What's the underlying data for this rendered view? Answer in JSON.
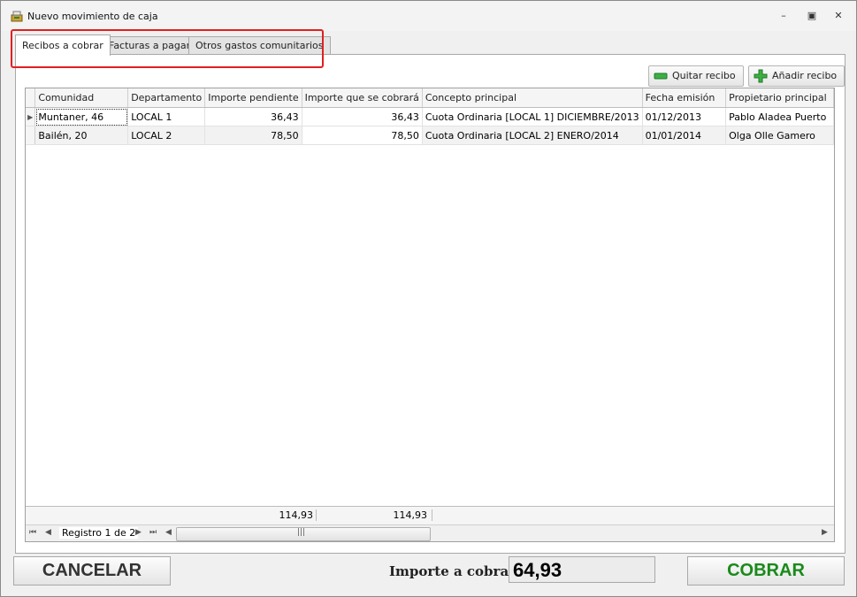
{
  "window": {
    "title": "Nuevo movimiento de caja",
    "controls": {
      "minimize": "–",
      "restore": "▣",
      "close": "✕"
    }
  },
  "tabs": [
    {
      "label": "Recibos a cobrar",
      "active": true
    },
    {
      "label": "Facturas a pagar",
      "active": false
    },
    {
      "label": "Otros gastos comunitarios",
      "active": false
    }
  ],
  "toolbar": {
    "remove_label": "Quitar recibo",
    "add_label": "Añadir recibo",
    "remove_icon": "minus-icon",
    "add_icon": "plus-icon"
  },
  "grid": {
    "columns": [
      "Comunidad",
      "Departamento",
      "Importe pendiente",
      "Importe que se cobrará",
      "Concepto principal",
      "Fecha emisión",
      "Propietario principal"
    ],
    "rows": [
      [
        "Muntaner, 46",
        "LOCAL 1",
        "36,43",
        "36,43",
        "Cuota Ordinaria [LOCAL 1] DICIEMBRE/2013",
        "01/12/2013",
        "Pablo Aladea Puerto"
      ],
      [
        "Bailén, 20",
        "LOCAL 2",
        "78,50",
        "78,50",
        "Cuota Ordinaria [LOCAL 2] ENERO/2014",
        "01/01/2014",
        "Olga Olle Gamero"
      ]
    ],
    "footer": {
      "total_pendiente": "114,93",
      "total_cobrara": "114,93"
    },
    "navigator": {
      "record_text": "Registro 1 de 2"
    }
  },
  "bottom": {
    "cancel_label": "CANCELAR",
    "amount_label": "Importe a cobrar:",
    "amount_value": "64,93",
    "submit_label": "COBRAR"
  },
  "colors": {
    "highlight": "#e02020",
    "submit_text": "#1a8a1a",
    "cancel_text": "#333333"
  }
}
